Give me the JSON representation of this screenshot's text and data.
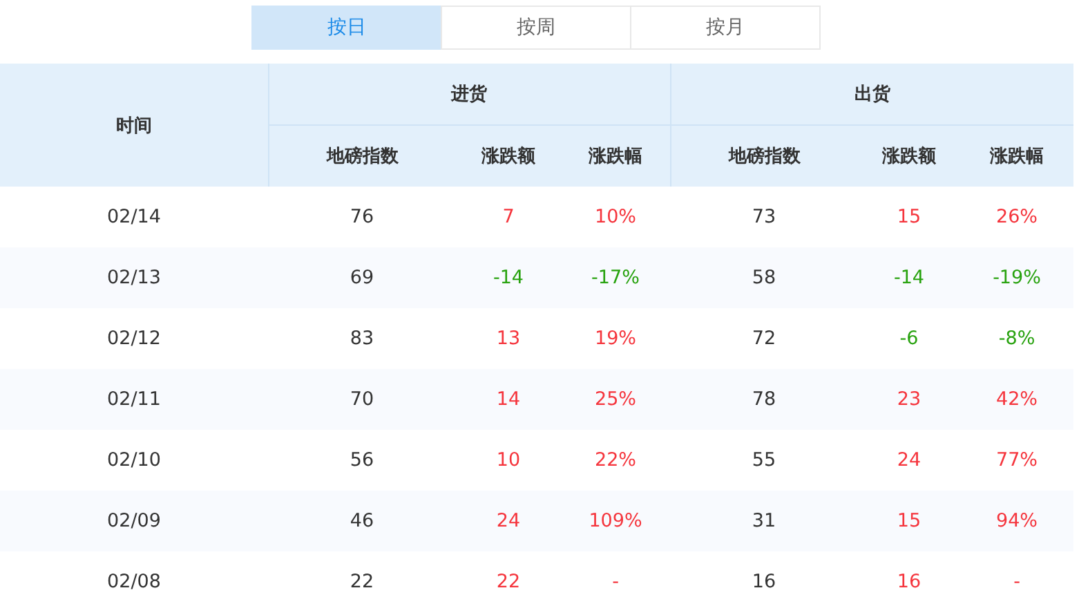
{
  "tabs": [
    {
      "label": "按日",
      "selected": true
    },
    {
      "label": "按周",
      "selected": false
    },
    {
      "label": "按月",
      "selected": false
    }
  ],
  "table": {
    "time_header": "时间",
    "groups": [
      {
        "title": "进货",
        "columns": [
          "地磅指数",
          "涨跌额",
          "涨跌幅"
        ]
      },
      {
        "title": "出货",
        "columns": [
          "地磅指数",
          "涨跌额",
          "涨跌幅"
        ]
      }
    ],
    "rows": [
      {
        "date": "02/14",
        "groups": [
          {
            "index": "76",
            "change": {
              "text": "7",
              "color": "#f5353d"
            },
            "pct": {
              "text": "10%",
              "color": "#f5353d"
            }
          },
          {
            "index": "73",
            "change": {
              "text": "15",
              "color": "#f5353d"
            },
            "pct": {
              "text": "26%",
              "color": "#f5353d"
            }
          }
        ]
      },
      {
        "date": "02/13",
        "groups": [
          {
            "index": "69",
            "change": {
              "text": "-14",
              "color": "#28a20f"
            },
            "pct": {
              "text": "-17%",
              "color": "#28a20f"
            }
          },
          {
            "index": "58",
            "change": {
              "text": "-14",
              "color": "#28a20f"
            },
            "pct": {
              "text": "-19%",
              "color": "#28a20f"
            }
          }
        ]
      },
      {
        "date": "02/12",
        "groups": [
          {
            "index": "83",
            "change": {
              "text": "13",
              "color": "#f5353d"
            },
            "pct": {
              "text": "19%",
              "color": "#f5353d"
            }
          },
          {
            "index": "72",
            "change": {
              "text": "-6",
              "color": "#28a20f"
            },
            "pct": {
              "text": "-8%",
              "color": "#28a20f"
            }
          }
        ]
      },
      {
        "date": "02/11",
        "groups": [
          {
            "index": "70",
            "change": {
              "text": "14",
              "color": "#f5353d"
            },
            "pct": {
              "text": "25%",
              "color": "#f5353d"
            }
          },
          {
            "index": "78",
            "change": {
              "text": "23",
              "color": "#f5353d"
            },
            "pct": {
              "text": "42%",
              "color": "#f5353d"
            }
          }
        ]
      },
      {
        "date": "02/10",
        "groups": [
          {
            "index": "56",
            "change": {
              "text": "10",
              "color": "#f5353d"
            },
            "pct": {
              "text": "22%",
              "color": "#f5353d"
            }
          },
          {
            "index": "55",
            "change": {
              "text": "24",
              "color": "#f5353d"
            },
            "pct": {
              "text": "77%",
              "color": "#f5353d"
            }
          }
        ]
      },
      {
        "date": "02/09",
        "groups": [
          {
            "index": "46",
            "change": {
              "text": "24",
              "color": "#f5353d"
            },
            "pct": {
              "text": "109%",
              "color": "#f5353d"
            }
          },
          {
            "index": "31",
            "change": {
              "text": "15",
              "color": "#f5353d"
            },
            "pct": {
              "text": "94%",
              "color": "#f5353d"
            }
          }
        ]
      },
      {
        "date": "02/08",
        "groups": [
          {
            "index": "22",
            "change": {
              "text": "22",
              "color": "#f5353d"
            },
            "pct": {
              "text": "-",
              "color": "#f5353d"
            }
          },
          {
            "index": "16",
            "change": {
              "text": "16",
              "color": "#f5353d"
            },
            "pct": {
              "text": "-",
              "color": "#f5353d"
            }
          }
        ]
      }
    ]
  }
}
